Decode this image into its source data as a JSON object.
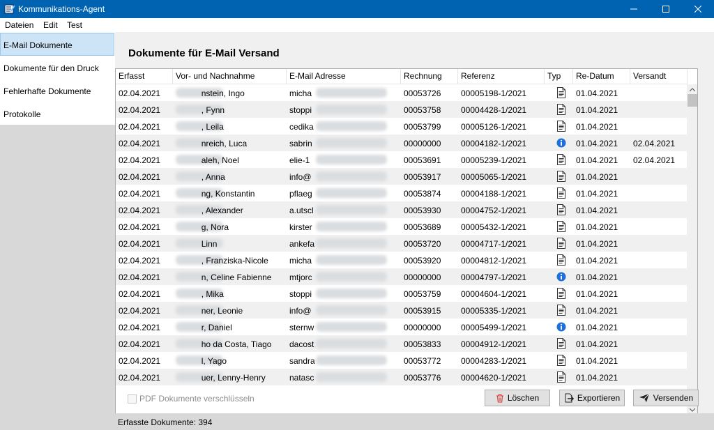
{
  "window": {
    "title": "Kommunikations-Agent"
  },
  "menu": [
    "Dateien",
    "Edit",
    "Test"
  ],
  "sidebar": {
    "items": [
      {
        "label": "E-Mail Dokumente"
      },
      {
        "label": "Dokumente für den Druck"
      },
      {
        "label": "Fehlerhafte Dokumente"
      },
      {
        "label": "Protokolle"
      }
    ]
  },
  "main": {
    "heading": "Dokumente für E-Mail Versand"
  },
  "table": {
    "columns": [
      "Erfasst",
      "Vor- und Nachnahme",
      "E-Mail Adresse",
      "Rechnung",
      "Referenz",
      "Typ",
      "Re-Datum",
      "Versandt"
    ],
    "rows": [
      {
        "erfasst": "02.04.2021",
        "name": "nstein, Ingo",
        "email": "micha",
        "rechnung": "00053726",
        "referenz": "00005198-1/2021",
        "typ": "document-icon",
        "redatum": "01.04.2021",
        "versandt": ""
      },
      {
        "erfasst": "02.04.2021",
        "name": ", Fynn",
        "email": "stoppi",
        "rechnung": "00053758",
        "referenz": "00004428-1/2021",
        "typ": "document-icon",
        "redatum": "01.04.2021",
        "versandt": ""
      },
      {
        "erfasst": "02.04.2021",
        "name": ", Leila",
        "email": "cedika",
        "rechnung": "00053799",
        "referenz": "00005126-1/2021",
        "typ": "document-icon",
        "redatum": "01.04.2021",
        "versandt": ""
      },
      {
        "erfasst": "02.04.2021",
        "name": "nreich, Luca",
        "email": "sabrin",
        "rechnung": "00000000",
        "referenz": "00004182-1/2021",
        "typ": "info-icon",
        "redatum": "01.04.2021",
        "versandt": "02.04.2021"
      },
      {
        "erfasst": "02.04.2021",
        "name": "aleh, Noel",
        "email": "elie-1",
        "rechnung": "00053691",
        "referenz": "00005239-1/2021",
        "typ": "document-icon",
        "redatum": "01.04.2021",
        "versandt": "02.04.2021"
      },
      {
        "erfasst": "02.04.2021",
        "name": ", Anna",
        "email": "info@",
        "rechnung": "00053917",
        "referenz": "00005065-1/2021",
        "typ": "document-icon",
        "redatum": "01.04.2021",
        "versandt": ""
      },
      {
        "erfasst": "02.04.2021",
        "name": "ng, Konstantin",
        "email": "pflaeg",
        "rechnung": "00053874",
        "referenz": "00004188-1/2021",
        "typ": "document-icon",
        "redatum": "01.04.2021",
        "versandt": ""
      },
      {
        "erfasst": "02.04.2021",
        "name": ", Alexander",
        "email": "a.utscl",
        "rechnung": "00053930",
        "referenz": "00004752-1/2021",
        "typ": "document-icon",
        "redatum": "01.04.2021",
        "versandt": ""
      },
      {
        "erfasst": "02.04.2021",
        "name": "g, Nora",
        "email": "kirster",
        "rechnung": "00053689",
        "referenz": "00005432-1/2021",
        "typ": "document-icon",
        "redatum": "01.04.2021",
        "versandt": ""
      },
      {
        "erfasst": "02.04.2021",
        "name": "Linn",
        "email": "ankefa",
        "rechnung": "00053720",
        "referenz": "00004717-1/2021",
        "typ": "document-icon",
        "redatum": "01.04.2021",
        "versandt": ""
      },
      {
        "erfasst": "02.04.2021",
        "name": ", Franziska-Nicole",
        "email": "micha",
        "rechnung": "00053920",
        "referenz": "00004812-1/2021",
        "typ": "document-icon",
        "redatum": "01.04.2021",
        "versandt": ""
      },
      {
        "erfasst": "02.04.2021",
        "name": "n, Celine Fabienne",
        "email": "mtjorc",
        "rechnung": "00000000",
        "referenz": "00004797-1/2021",
        "typ": "info-icon",
        "redatum": "01.04.2021",
        "versandt": ""
      },
      {
        "erfasst": "02.04.2021",
        "name": ", Mika",
        "email": "stoppi",
        "rechnung": "00053759",
        "referenz": "00004604-1/2021",
        "typ": "document-icon",
        "redatum": "01.04.2021",
        "versandt": ""
      },
      {
        "erfasst": "02.04.2021",
        "name": "ner, Leonie",
        "email": "info@",
        "rechnung": "00053915",
        "referenz": "00005335-1/2021",
        "typ": "document-icon",
        "redatum": "01.04.2021",
        "versandt": ""
      },
      {
        "erfasst": "02.04.2021",
        "name": "r, Daniel",
        "email": "sternw",
        "rechnung": "00000000",
        "referenz": "00005499-1/2021",
        "typ": "info-icon",
        "redatum": "01.04.2021",
        "versandt": ""
      },
      {
        "erfasst": "02.04.2021",
        "name": "ho da Costa, Tiago",
        "email": "dacost",
        "rechnung": "00053833",
        "referenz": "00004912-1/2021",
        "typ": "document-icon",
        "redatum": "01.04.2021",
        "versandt": ""
      },
      {
        "erfasst": "02.04.2021",
        "name": "l, Yago",
        "email": "sandra",
        "rechnung": "00053772",
        "referenz": "00004283-1/2021",
        "typ": "document-icon",
        "redatum": "01.04.2021",
        "versandt": ""
      },
      {
        "erfasst": "02.04.2021",
        "name": "uer, Lenny-Henry",
        "email": "natasc",
        "rechnung": "00053776",
        "referenz": "00004620-1/2021",
        "typ": "document-icon",
        "redatum": "01.04.2021",
        "versandt": ""
      }
    ]
  },
  "options": {
    "encrypt_label": "PDF Dokumente verschlüsseln",
    "encrypt_checked": false
  },
  "buttons": {
    "delete": {
      "label": "Löschen",
      "icon": "trash-icon"
    },
    "export": {
      "label": "Exportieren",
      "icon": "export-icon"
    },
    "send": {
      "label": "Versenden",
      "icon": "send-icon"
    }
  },
  "status": {
    "text": "Erfasste Dokumente: 394"
  },
  "colors": {
    "titlebar": "#0063b1",
    "selected": "#cde4f7",
    "info": "#1e6fd9",
    "delete_icon": "#d9322b"
  }
}
